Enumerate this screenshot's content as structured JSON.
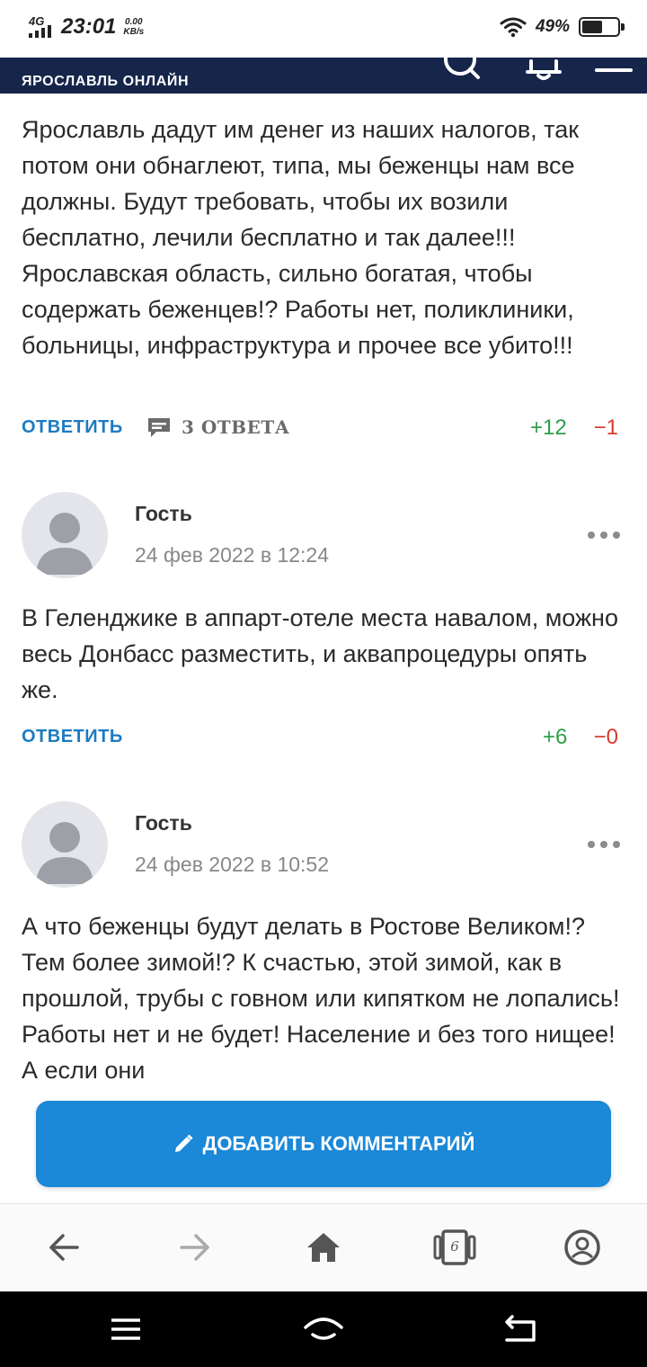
{
  "status_bar": {
    "network": "4G",
    "time": "23:01",
    "speed_value": "0.00",
    "speed_unit": "KB/s",
    "battery": "49%"
  },
  "site": {
    "subtitle": "ЯРОСЛАВЛЬ ОНЛАЙН",
    "brand_red": "#e2231a",
    "header_bg": "#16254a"
  },
  "comments": [
    {
      "text": "Ярославль дадут им денег из наших налогов, так потом они обнаглеют, типа, мы беженцы нам все должны. Будут требовать, чтобы их возили бесплатно, лечили бесплатно и так далее!!! Ярославская область, сильно богатая, чтобы содержать беженцев!? Работы нет, поликлиники, больницы, инфраструктура и прочее все убито!!!",
      "reply_label": "ОТВЕТИТЬ",
      "answers_label": "3 ОТВЕТА",
      "votes_up": "+12",
      "votes_down": "−1"
    },
    {
      "author": "Гость",
      "date": "24 фев 2022 в 12:24",
      "text": "В Геленджике в аппарт-отеле места навалом, можно весь Донбасс разместить, и аквапроцедуры опять же.",
      "reply_label": "ОТВЕТИТЬ",
      "votes_up": "+6",
      "votes_down": "−0"
    },
    {
      "author": "Гость",
      "date": "24 фев 2022 в 10:52",
      "text": "А что беженцы будут делать в Ростове Великом!? Тем более зимой!? К счастью, этой зимой, как в прошлой, трубы с говном или кипятком не лопались! Работы нет и не будет! Население и без того нищее! А если они"
    }
  ],
  "add_comment": {
    "label": "ДОБАВИТЬ КОММЕНТАРИЙ",
    "icon": "pencil-icon"
  },
  "browser_bar": {
    "tabs_count": "6"
  },
  "colors": {
    "link_blue": "#1d7bc1",
    "button_blue": "#1b88d8",
    "vote_up": "#2e9f4a",
    "vote_down": "#d63a2f"
  }
}
